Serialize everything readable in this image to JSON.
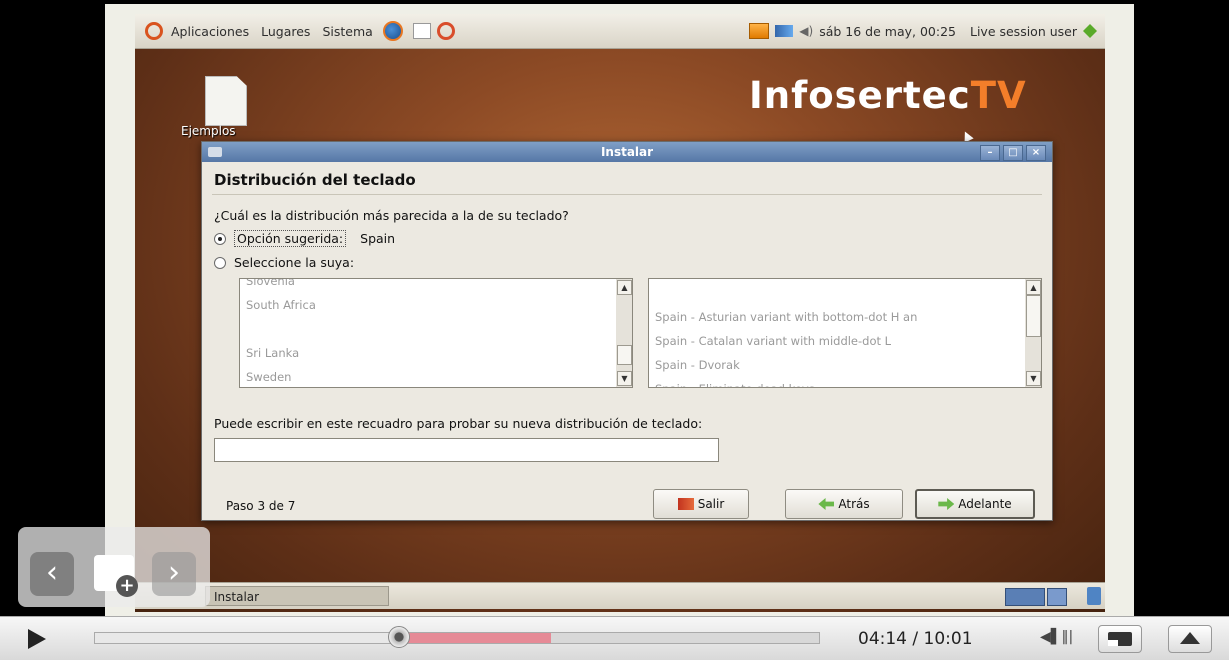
{
  "toppanel": {
    "menu_apps": "Aplicaciones",
    "menu_places": "Lugares",
    "menu_system": "Sistema",
    "clock": "sáb 16 de may, 00:25",
    "session": "Live session user"
  },
  "desktop": {
    "icon_label": "Ejemplos",
    "brand_main": "Infosertec",
    "brand_suffix": "TV"
  },
  "dialog": {
    "title": "Instalar",
    "heading": "Distribución del teclado",
    "question": "¿Cuál es la distribución más parecida a la de su teclado?",
    "suggested_label": "Opción sugerida:",
    "suggested_value": "Spain",
    "choose_label": "Seleccione la suya:",
    "countries": [
      "Slovenia",
      "South Africa",
      "",
      "Sri Lanka",
      "Sweden"
    ],
    "variants": [
      "",
      "Spain - Asturian variant with bottom-dot H an",
      "Spain - Catalan variant with middle-dot L",
      "Spain - Dvorak",
      "Spain - Eliminate dead keys"
    ],
    "test_prompt": "Puede escribir en este recuadro para probar su nueva distribución de teclado:",
    "test_value": "",
    "step": "Paso 3 de 7",
    "btn_quit": "Salir",
    "btn_back": "Atrás",
    "btn_forward": "Adelante"
  },
  "taskbar": {
    "task_label": "Instalar"
  },
  "player": {
    "time": "04:14 / 10:01",
    "progress": 0.42,
    "buffered_end": 0.63
  },
  "icons": [
    "ubuntu-logo-icon",
    "firefox-icon",
    "help-icon",
    "mail-icon",
    "network-icon",
    "volume-icon",
    "quit-icon",
    "play-icon",
    "volume-icon",
    "mini-player-icon",
    "expand-icon"
  ],
  "colors": {
    "brand_accent": "#f37e2a",
    "titlebar": "#6a8ab8",
    "buffered": "#e68a96"
  }
}
